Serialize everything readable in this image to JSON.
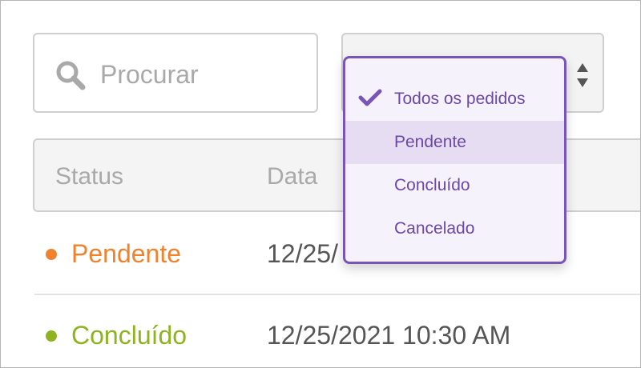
{
  "search": {
    "placeholder": "Procurar",
    "icon": "search-icon"
  },
  "filter": {
    "icon": "sort-arrows-icon",
    "options": [
      {
        "label": "Todos os pedidos",
        "selected": true
      },
      {
        "label": "Pendente",
        "selected": false,
        "hovered": true
      },
      {
        "label": "Concluído",
        "selected": false
      },
      {
        "label": "Cancelado",
        "selected": false
      }
    ]
  },
  "table": {
    "columns": [
      "Status",
      "Data"
    ],
    "rows": [
      {
        "status": "Pendente",
        "status_color": "#f0822e",
        "date": "12/25/"
      },
      {
        "status": "Concluído",
        "status_color": "#8db41f",
        "date": "12/25/2021 10:30 AM"
      }
    ]
  },
  "colors": {
    "accent": "#7a55b8",
    "option_text": "#6b47a8",
    "pending": "#f0822e",
    "completed": "#8db41f"
  }
}
